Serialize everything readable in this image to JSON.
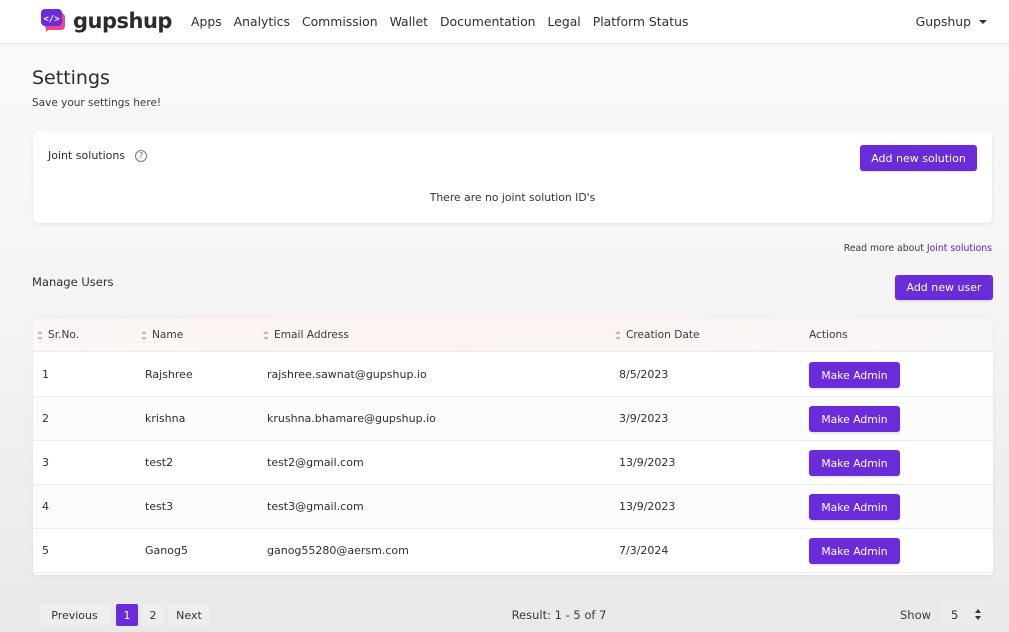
{
  "brand": {
    "name": "gupshup",
    "accent": "#6a2bd9"
  },
  "nav": {
    "links": [
      "Apps",
      "Analytics",
      "Commission",
      "Wallet",
      "Documentation",
      "Legal",
      "Platform Status"
    ],
    "user": "Gupshup"
  },
  "page": {
    "title": "Settings",
    "subtitle": "Save your settings here!"
  },
  "joint": {
    "title": "Joint solutions",
    "help_icon": "?",
    "add_label": "Add new solution",
    "empty": "There are no joint solution ID's",
    "read_more_prefix": "Read more about ",
    "read_more_link": "Joint solutions"
  },
  "users": {
    "title": "Manage Users",
    "add_label": "Add new user",
    "columns": [
      "Sr.No.",
      "Name",
      "Email Address",
      "Creation Date",
      "Actions"
    ],
    "rows": [
      {
        "sr": "1",
        "name": "Rajshree",
        "email": "rajshree.sawnat@gupshup.io",
        "date": "8/5/2023",
        "action": "Make Admin"
      },
      {
        "sr": "2",
        "name": "krishna",
        "email": "krushna.bhamare@gupshup.io",
        "date": "3/9/2023",
        "action": "Make Admin"
      },
      {
        "sr": "3",
        "name": "test2",
        "email": "test2@gmail.com",
        "date": "13/9/2023",
        "action": "Make Admin"
      },
      {
        "sr": "4",
        "name": "test3",
        "email": "test3@gmail.com",
        "date": "13/9/2023",
        "action": "Make Admin"
      },
      {
        "sr": "5",
        "name": "Ganog5",
        "email": "ganog55280@aersm.com",
        "date": "7/3/2024",
        "action": "Make Admin"
      }
    ]
  },
  "pagination": {
    "prev": "Previous",
    "pages": [
      "1",
      "2"
    ],
    "current": "1",
    "next": "Next",
    "result": "Result: 1 - 5 of 7",
    "show_label": "Show",
    "show_value": "5"
  }
}
